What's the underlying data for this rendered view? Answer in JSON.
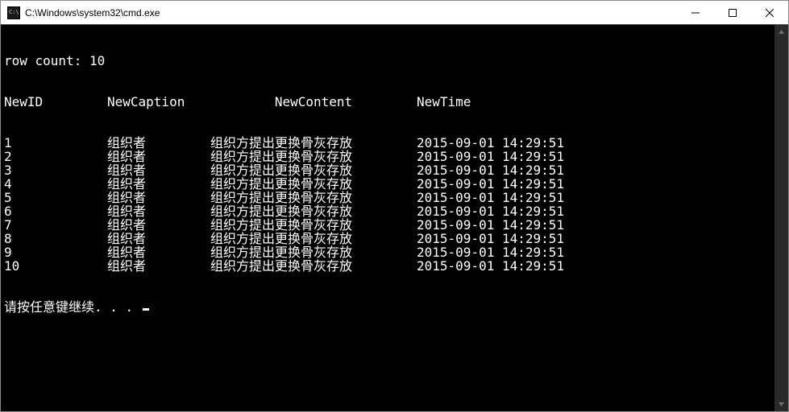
{
  "window": {
    "title": "C:\\Windows\\system32\\cmd.exe"
  },
  "console": {
    "row_count_label": "row count: 10",
    "headers": {
      "id": "NewID",
      "caption": "NewCaption",
      "content": "NewContent",
      "time": "NewTime"
    },
    "rows": [
      {
        "id": "1",
        "caption": "组织者",
        "content": "组织方提出更换骨灰存放",
        "time": "2015-09-01 14:29:51"
      },
      {
        "id": "2",
        "caption": "组织者",
        "content": "组织方提出更换骨灰存放",
        "time": "2015-09-01 14:29:51"
      },
      {
        "id": "3",
        "caption": "组织者",
        "content": "组织方提出更换骨灰存放",
        "time": "2015-09-01 14:29:51"
      },
      {
        "id": "4",
        "caption": "组织者",
        "content": "组织方提出更换骨灰存放",
        "time": "2015-09-01 14:29:51"
      },
      {
        "id": "5",
        "caption": "组织者",
        "content": "组织方提出更换骨灰存放",
        "time": "2015-09-01 14:29:51"
      },
      {
        "id": "6",
        "caption": "组织者",
        "content": "组织方提出更换骨灰存放",
        "time": "2015-09-01 14:29:51"
      },
      {
        "id": "7",
        "caption": "组织者",
        "content": "组织方提出更换骨灰存放",
        "time": "2015-09-01 14:29:51"
      },
      {
        "id": "8",
        "caption": "组织者",
        "content": "组织方提出更换骨灰存放",
        "time": "2015-09-01 14:29:51"
      },
      {
        "id": "9",
        "caption": "组织者",
        "content": "组织方提出更换骨灰存放",
        "time": "2015-09-01 14:29:51"
      },
      {
        "id": "10",
        "caption": "组织者",
        "content": "组织方提出更换骨灰存放",
        "time": "2015-09-01 14:29:51"
      }
    ],
    "prompt": "请按任意键继续. . . "
  }
}
